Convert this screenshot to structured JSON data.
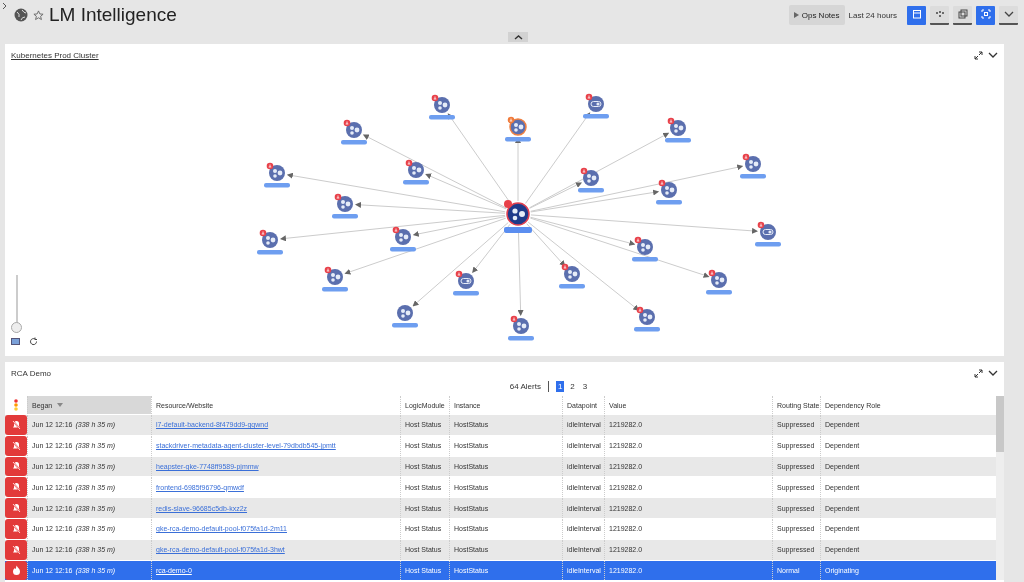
{
  "header": {
    "title": "LM Intelligence",
    "favorite": false,
    "ops_notes": "Ops Notes",
    "time_range": "Last 24 hours",
    "tools": [
      {
        "kind": "calendar",
        "active": true
      },
      {
        "kind": "dots",
        "active": false
      },
      {
        "kind": "copy",
        "active": false
      },
      {
        "kind": "fit",
        "active": true
      },
      {
        "kind": "chevron",
        "active": false
      }
    ]
  },
  "topology_panel": {
    "title": "Kubernetes Prod Cluster",
    "zoom": {
      "level": 0
    }
  },
  "alerts_panel": {
    "title": "RCA Demo",
    "count": "64 Alerts",
    "pages": [
      {
        "label": "1",
        "selected": true
      },
      {
        "label": "2",
        "selected": false
      },
      {
        "label": "3",
        "selected": false
      }
    ],
    "columns": [
      "Began",
      "Resource/Website",
      "LogicModule",
      "Instance",
      "Datapoint",
      "Value",
      "Routing State",
      "Dependency Role"
    ],
    "rows": [
      {
        "kind": "suppressed",
        "selected": false,
        "began": "Jun 12 12:16 *(338 h 35 m)*",
        "resource": "l7-default-backend-8f479dd9-gqwnd",
        "module": "Host Status",
        "instance": "HostStatus",
        "datapoint": "idleInterval",
        "value": "1219282.0",
        "routing": "Suppressed",
        "role": "Dependent"
      },
      {
        "kind": "suppressed",
        "selected": false,
        "began": "Jun 12 12:16 *(338 h 35 m)*",
        "resource": "stackdriver-metadata-agent-cluster-level-79dbdb545-jpmtt",
        "module": "Host Status",
        "instance": "HostStatus",
        "datapoint": "idleInterval",
        "value": "1219282.0",
        "routing": "Suppressed",
        "role": "Dependent"
      },
      {
        "kind": "suppressed",
        "selected": false,
        "began": "Jun 12 12:16 *(338 h 35 m)*",
        "resource": "heapster-gke-7748ff9589-pjmmw",
        "module": "Host Status",
        "instance": "HostStatus",
        "datapoint": "idleInterval",
        "value": "1219282.0",
        "routing": "Suppressed",
        "role": "Dependent"
      },
      {
        "kind": "suppressed",
        "selected": false,
        "began": "Jun 12 12:16 *(338 h 35 m)*",
        "resource": "frontend-6985f96796-qmwdf",
        "module": "Host Status",
        "instance": "HostStatus",
        "datapoint": "idleInterval",
        "value": "1219282.0",
        "routing": "Suppressed",
        "role": "Dependent"
      },
      {
        "kind": "suppressed",
        "selected": false,
        "began": "Jun 12 12:16 *(338 h 35 m)*",
        "resource": "redis-slave-96685c5db-kxz2z",
        "module": "Host Status",
        "instance": "HostStatus",
        "datapoint": "idleInterval",
        "value": "1219282.0",
        "routing": "Suppressed",
        "role": "Dependent"
      },
      {
        "kind": "suppressed",
        "selected": false,
        "began": "Jun 12 12:16 *(338 h 35 m)*",
        "resource": "gke-rca-demo-default-pool-f075fa1d-2m11",
        "module": "Host Status",
        "instance": "HostStatus",
        "datapoint": "idleInterval",
        "value": "1219282.0",
        "routing": "Suppressed",
        "role": "Dependent"
      },
      {
        "kind": "suppressed",
        "selected": false,
        "began": "Jun 12 12:16 *(338 h 35 m)*",
        "resource": "gke-rca-demo-default-pool-f075fa1d-3hwt",
        "module": "Host Status",
        "instance": "HostStatus",
        "datapoint": "idleInterval",
        "value": "1219282.0",
        "routing": "Suppressed",
        "role": "Dependent"
      },
      {
        "kind": "originating",
        "selected": true,
        "began": "Jun 12 12:16 *(338 h 35 m)*",
        "resource": "rca-demo-0",
        "module": "Host Status",
        "instance": "HostStatus",
        "datapoint": "idleInterval",
        "value": "1219282.0",
        "routing": "Normal",
        "role": "Originating"
      }
    ]
  }
}
